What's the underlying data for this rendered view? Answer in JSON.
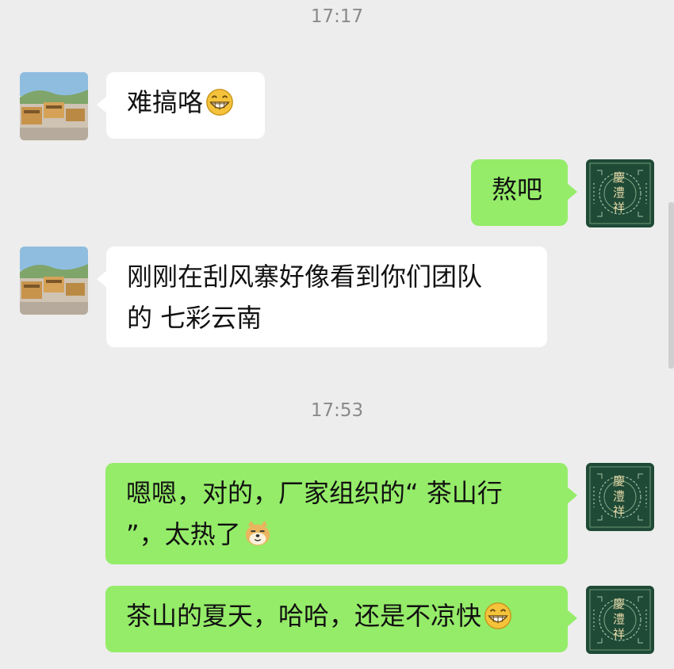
{
  "chat": {
    "timestamps": [
      "17:17",
      "17:53"
    ],
    "messages": [
      {
        "side": "in",
        "text": "难搞咯",
        "emoji": "grin-emoji"
      },
      {
        "side": "out",
        "text": "熬吧"
      },
      {
        "side": "in",
        "line1": "刚刚在刮风寨好像看到你们团队",
        "line2": "的 七彩云南"
      },
      {
        "side": "out",
        "line1": "嗯嗯，对的，厂家组织的“ 茶山行",
        "line2": "”，太热了",
        "emoji": "doge-emoji"
      },
      {
        "side": "out",
        "text": "茶山的夏天，哈哈，还是不凉快",
        "emoji": "grin-emoji"
      }
    ],
    "self_avatar_text": "慶澧祥"
  },
  "colors": {
    "background": "#ededed",
    "incoming_bubble": "#ffffff",
    "outgoing_bubble": "#95ec69",
    "timestamp": "#8a8a8a"
  }
}
